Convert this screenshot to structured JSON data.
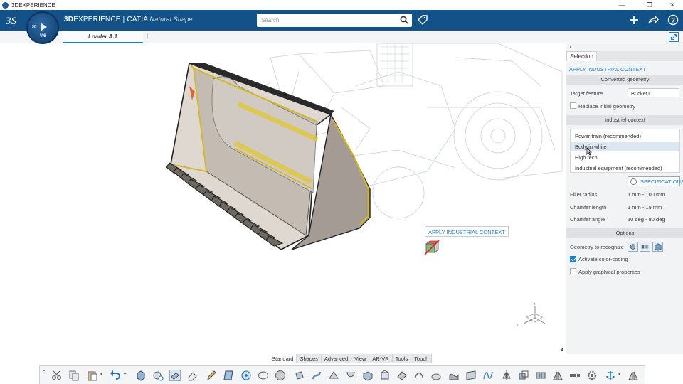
{
  "window": {
    "title": "3DEXPERIENCE"
  },
  "header": {
    "brand_bold": "3D",
    "brand_rest": "EXPERIENCE | CATIA",
    "app_name": "Natural Shape",
    "search_placeholder": "Search",
    "compass_version": "V.6",
    "compass_3d": "3D"
  },
  "tabs": [
    {
      "label": "Loader A.1"
    }
  ],
  "panel": {
    "tab_label": "Selection",
    "command_title": "APPLY INDUSTRIAL CONTEXT",
    "converted": {
      "header": "Converted geometry",
      "target_label": "Target feature",
      "target_value": "Bucket1",
      "replace_label": "Replace initial geometry",
      "replace_checked": false
    },
    "context": {
      "header": "Industrial context",
      "items": [
        {
          "label": "Power train (recommended)",
          "selected": false
        },
        {
          "label": "Body in white",
          "selected": true
        },
        {
          "label": "High tech",
          "selected": false
        },
        {
          "label": "Industrial equipment (recommended)",
          "selected": false
        }
      ],
      "spec_button": "SPECIFICATIONS",
      "fillet_label": "Fillet radius",
      "fillet_value": "1 mm - 100 mm",
      "chamfer_len_label": "Chamfer length",
      "chamfer_len_value": "1 mm - 15 mm",
      "chamfer_ang_label": "Chamfer angle",
      "chamfer_ang_value": "10 deg - 80 deg"
    },
    "options": {
      "header": "Options",
      "geometry_label": "Geometry to recognize",
      "color_coding_label": "Activate color-coding",
      "color_coding_checked": true,
      "graphical_label": "Apply graphical properties",
      "graphical_checked": false
    }
  },
  "viewport": {
    "floating_command": "APPLY INDUSTRIAL CONTEXT"
  },
  "section_tabs": [
    "Standard",
    "Shapes",
    "Advanced",
    "View",
    "AR-VR",
    "Tools",
    "Touch"
  ],
  "active_section_tab": "Standard",
  "colors": {
    "header_blue": "#125289",
    "accent": "#1f7ec3",
    "bucket_edge": "#e0c020"
  }
}
